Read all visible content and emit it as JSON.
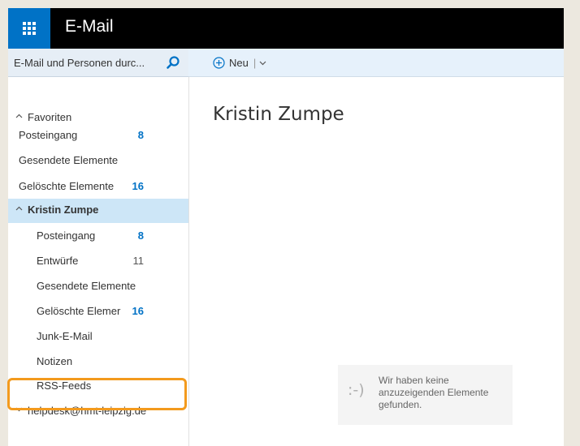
{
  "app": {
    "title": "E-Mail"
  },
  "search": {
    "placeholder": "E-Mail und Personen durc..."
  },
  "toolbar": {
    "new_label": "Neu",
    "separator": "|"
  },
  "sidebar": {
    "favorites": {
      "label": "Favoriten",
      "items": [
        {
          "label": "Posteingang",
          "count": "8"
        },
        {
          "label": "Gesendete Elemente",
          "count": ""
        },
        {
          "label": "Gelöschte Elemente",
          "count": "16"
        }
      ]
    },
    "account": {
      "label": "Kristin Zumpe",
      "items": [
        {
          "label": "Posteingang",
          "count": "8"
        },
        {
          "label": "Entwürfe",
          "count": "11"
        },
        {
          "label": "Gesendete Elemente",
          "count": ""
        },
        {
          "label": "Gelöschte Elemer",
          "count": "16"
        },
        {
          "label": "Junk-E-Mail",
          "count": ""
        },
        {
          "label": "Notizen",
          "count": ""
        },
        {
          "label": "RSS-Feeds",
          "count": ""
        }
      ]
    },
    "shared": {
      "label": "helpdesk@hmt-leipzig.de"
    }
  },
  "main": {
    "title": "Kristin Zumpe",
    "empty_smiley": ":-)",
    "empty_message": "Wir haben keine anzuzeigenden Elemente gefunden."
  },
  "colors": {
    "brand": "#0072c6",
    "selected": "#cde6f7",
    "highlight": "#f39a1d"
  }
}
